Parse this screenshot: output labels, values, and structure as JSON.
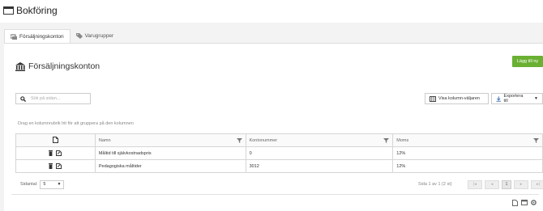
{
  "app": {
    "title": "Bokföring"
  },
  "tabs": [
    {
      "label": "Försäljningskonton",
      "icon": "money-icon",
      "active": true
    },
    {
      "label": "Varugrupper",
      "icon": "tags-icon",
      "active": false
    }
  ],
  "card": {
    "title": "Försäljningskonton",
    "title_icon": "bank-icon",
    "add_label": "Lägg till ny"
  },
  "toolbar": {
    "search_placeholder": "Sök på sidan...",
    "column_chooser_label": "Visa kolumn-väljaren",
    "export_label": "Exportera till"
  },
  "grid": {
    "group_hint": "Drag en kolumnrubrik hit för att gruppera på den kolumnen",
    "columns": [
      "",
      "Namn",
      "Kontonummer",
      "Moms"
    ],
    "rows": [
      {
        "name": "Måltid till självkostnadspris",
        "account": "0",
        "vat": "12%"
      },
      {
        "name": "Pedagogiska måltider",
        "account": "3012",
        "vat": "12%"
      }
    ]
  },
  "pager": {
    "page_size_label": "Sidantal:",
    "page_size": "5",
    "info": "Sida 1 av 1 (2 st)",
    "current": "1"
  },
  "colors": {
    "accent": "#6ab033",
    "background": "#f3f3f3"
  }
}
